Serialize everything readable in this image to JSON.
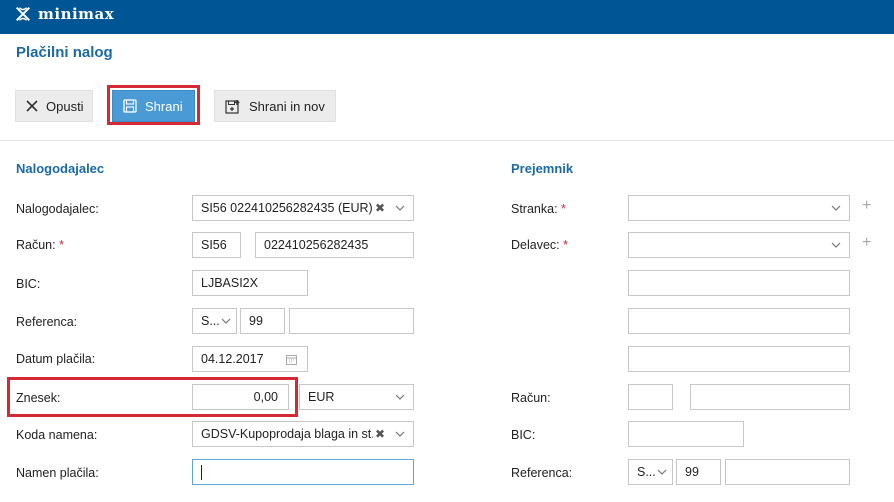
{
  "app": {
    "name": "minimax",
    "logo_icon": "minimax-logo-icon",
    "brand_color": "#005594"
  },
  "page": {
    "title": "Plačilni nalog"
  },
  "toolbar": {
    "cancel_label": "Opusti",
    "save_label": "Shrani",
    "save_new_label": "Shrani in nov"
  },
  "payer": {
    "section_title": "Nalogodajalec",
    "payer_label": "Nalogodajalec:",
    "payer_value": "SI56 022410256282435 (EUR)",
    "account_label": "Račun:",
    "account_required": "*",
    "account_prefix": "SI56",
    "account_number": "022410256282435",
    "bic_label": "BIC:",
    "bic_value": "LJBASI2X",
    "reference_label": "Referenca:",
    "reference_model": "S...",
    "reference_code": "99",
    "reference_number": "",
    "date_label": "Datum plačila:",
    "date_value": "04.12.2017",
    "amount_label": "Znesek:",
    "amount_value": "0,00",
    "currency_value": "EUR",
    "purpose_code_label": "Koda namena:",
    "purpose_code_value": "GDSV-Kupoprodaja blaga in st...",
    "purpose_label": "Namen plačila:",
    "purpose_value": ""
  },
  "recipient": {
    "section_title": "Prejemnik",
    "customer_label": "Stranka:",
    "customer_required": "*",
    "customer_value": "",
    "employee_label": "Delavec:",
    "employee_required": "*",
    "employee_value": "",
    "address1": "",
    "address2": "",
    "address3": "",
    "account_label": "Račun:",
    "account_prefix": "",
    "account_number": "",
    "bic_label": "BIC:",
    "bic_value": "",
    "reference_label": "Referenca:",
    "reference_model": "S...",
    "reference_code": "99",
    "reference_number": ""
  },
  "colors": {
    "section_title": "#1b6aa6",
    "required": "#d42a35",
    "highlight": "#d42a35",
    "primary_button": "#4a9ad6"
  }
}
